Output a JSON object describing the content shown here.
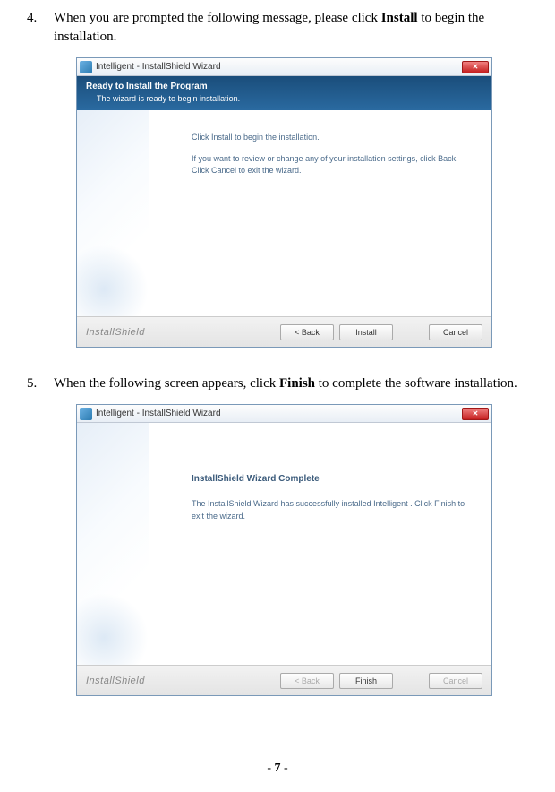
{
  "step4": {
    "num": "4.",
    "text_before": "When you are prompted the following message, please click ",
    "bold": "Install",
    "text_after": " to begin the installation."
  },
  "step5": {
    "num": "5.",
    "text_before": "When the following screen appears, click ",
    "bold": "Finish",
    "text_after": " to complete the software installation."
  },
  "wizard1": {
    "title": "Intelligent - InstallShield Wizard",
    "banner_title": "Ready to Install the Program",
    "banner_sub": "The wizard is ready to begin installation.",
    "body_line1": "Click Install to begin the installation.",
    "body_line2": "If you want to review or change any of your installation settings, click Back. Click Cancel to exit the wizard.",
    "brand": "InstallShield",
    "btn_back": "< Back",
    "btn_install": "Install",
    "btn_cancel": "Cancel"
  },
  "wizard2": {
    "title": "Intelligent - InstallShield Wizard",
    "body_title": "InstallShield Wizard Complete",
    "body_line1": "The InstallShield Wizard has successfully installed Intelligent . Click Finish to exit the wizard.",
    "brand": "InstallShield",
    "btn_back": "< Back",
    "btn_finish": "Finish",
    "btn_cancel": "Cancel"
  },
  "page_number": "7"
}
